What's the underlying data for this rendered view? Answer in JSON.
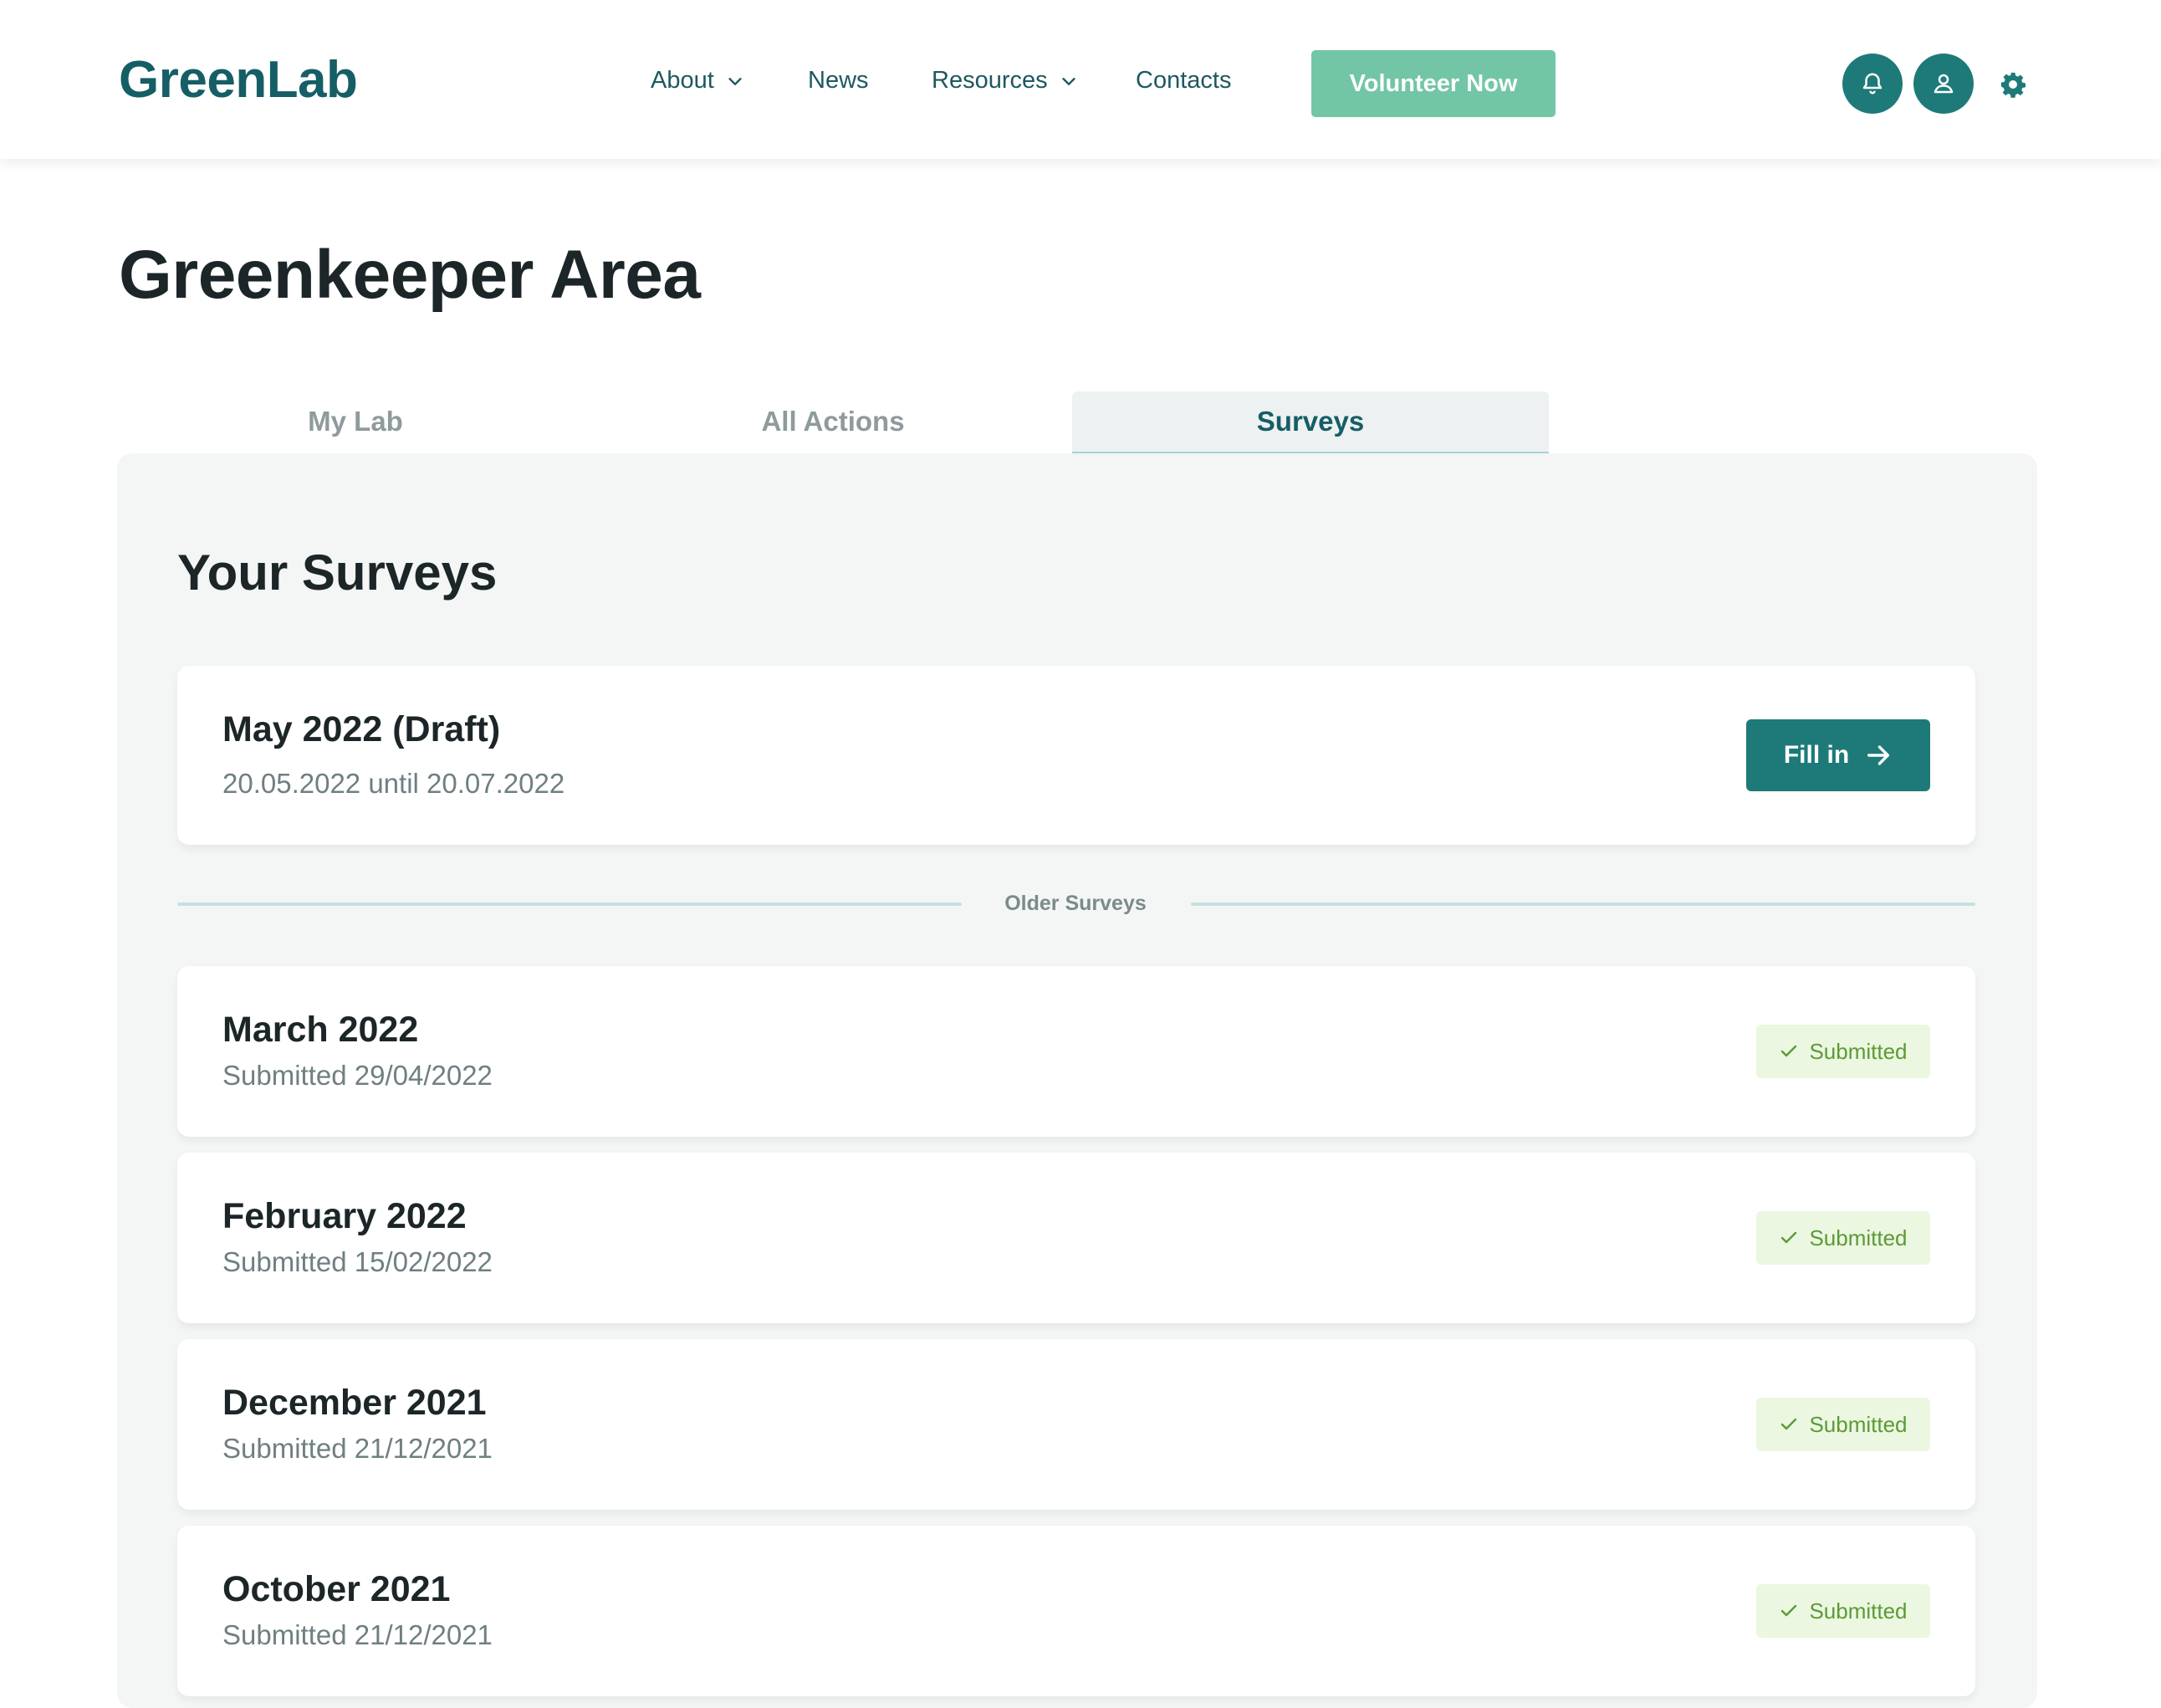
{
  "header": {
    "logo": "GreenLab",
    "nav": [
      {
        "label": "About"
      },
      {
        "label": "News"
      },
      {
        "label": "Resources"
      },
      {
        "label": "Contacts"
      }
    ],
    "cta_label": "Volunteer Now",
    "icons": [
      "bell-icon",
      "user-icon",
      "gear-icon"
    ]
  },
  "page": {
    "title": "Greenkeeper Area"
  },
  "tabs": [
    {
      "label": "My Lab",
      "active": false
    },
    {
      "label": "All Actions",
      "active": false
    },
    {
      "label": "Surveys",
      "active": true
    }
  ],
  "surveys": {
    "heading": "Your Surveys",
    "current": {
      "title": "May 2022 (Draft)",
      "range": "20.05.2022 until 20.07.2022",
      "action_label": "Fill in"
    },
    "older_label": "Older Surveys",
    "older": [
      {
        "title": "March 2022",
        "submitted": "Submitted 29/04/2022",
        "status": "Submitted"
      },
      {
        "title": "February 2022",
        "submitted": "Submitted 15/02/2022",
        "status": "Submitted"
      },
      {
        "title": "December 2021",
        "submitted": "Submitted 21/12/2021",
        "status": "Submitted"
      },
      {
        "title": "October 2021",
        "submitted": "Submitted 21/12/2021",
        "status": "Submitted"
      }
    ]
  },
  "colors": {
    "brand": "#155e66",
    "primary_button": "#1e7a78",
    "cta": "#72c6a5",
    "status_text": "#5c9a36",
    "status_bg": "#ebf7e1"
  }
}
